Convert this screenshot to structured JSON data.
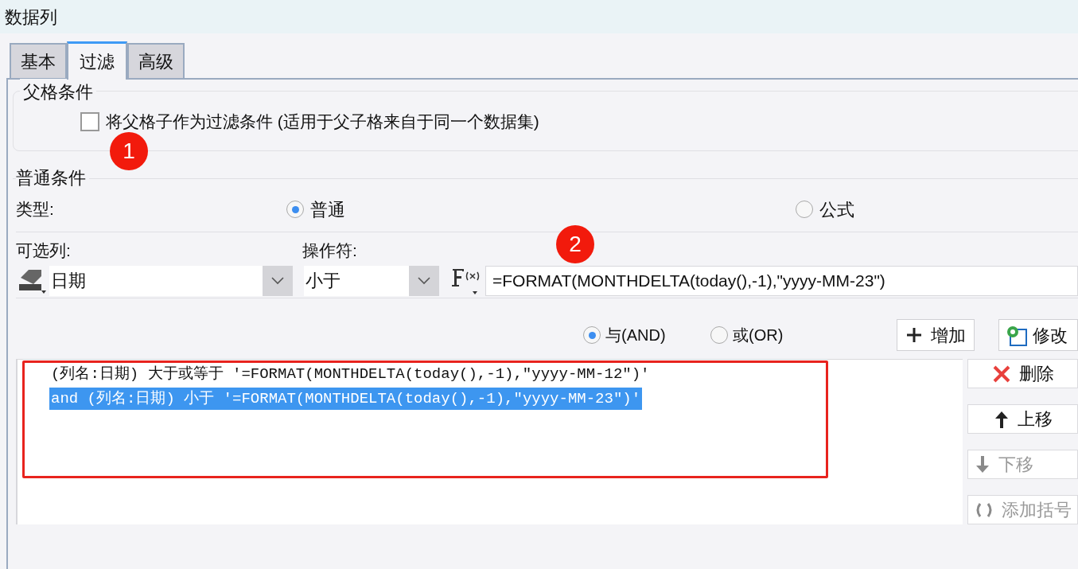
{
  "window": {
    "title": "数据列"
  },
  "tabs": [
    {
      "label": "基本",
      "selected": false
    },
    {
      "label": "过滤",
      "selected": true
    },
    {
      "label": "高级",
      "selected": false
    }
  ],
  "parent_condition": {
    "legend": "父格条件",
    "checkbox": {
      "label": "将父格子作为过滤条件 (适用于父子格来自于同一个数据集)",
      "checked": false
    }
  },
  "annotations": [
    {
      "label": "1"
    },
    {
      "label": "2"
    }
  ],
  "normal_condition": {
    "legend": "普通条件",
    "type": {
      "label": "类型:",
      "options": [
        {
          "label": "普通",
          "selected": true
        },
        {
          "label": "公式",
          "selected": false
        }
      ]
    },
    "column": {
      "label": "可选列:",
      "value": "日期"
    },
    "operator": {
      "label": "操作符:",
      "value": "小于"
    },
    "formula": {
      "value": "=FORMAT(MONTHDELTA(today(),-1),\"yyyy-MM-23\")"
    },
    "logic": [
      {
        "label": "与(AND)",
        "selected": true
      },
      {
        "label": "或(OR)",
        "selected": false
      }
    ],
    "top_buttons": [
      {
        "label": "增加",
        "kind": "add"
      },
      {
        "label": "修改",
        "kind": "modify"
      }
    ],
    "conditions": [
      {
        "text": "(列名:日期) 大于或等于 '=FORMAT(MONTHDELTA(today(),-1),\"yyyy-MM-12\")'",
        "selected": false
      },
      {
        "text": "and (列名:日期) 小于 '=FORMAT(MONTHDELTA(today(),-1),\"yyyy-MM-23\")'",
        "selected": true
      }
    ],
    "side_buttons": [
      {
        "label": "删除",
        "kind": "delete",
        "disabled": false
      },
      {
        "label": "上移",
        "kind": "up",
        "disabled": false
      },
      {
        "label": "下移",
        "kind": "down",
        "disabled": true
      },
      {
        "label": "添加括号",
        "kind": "paren",
        "disabled": true
      }
    ]
  }
}
